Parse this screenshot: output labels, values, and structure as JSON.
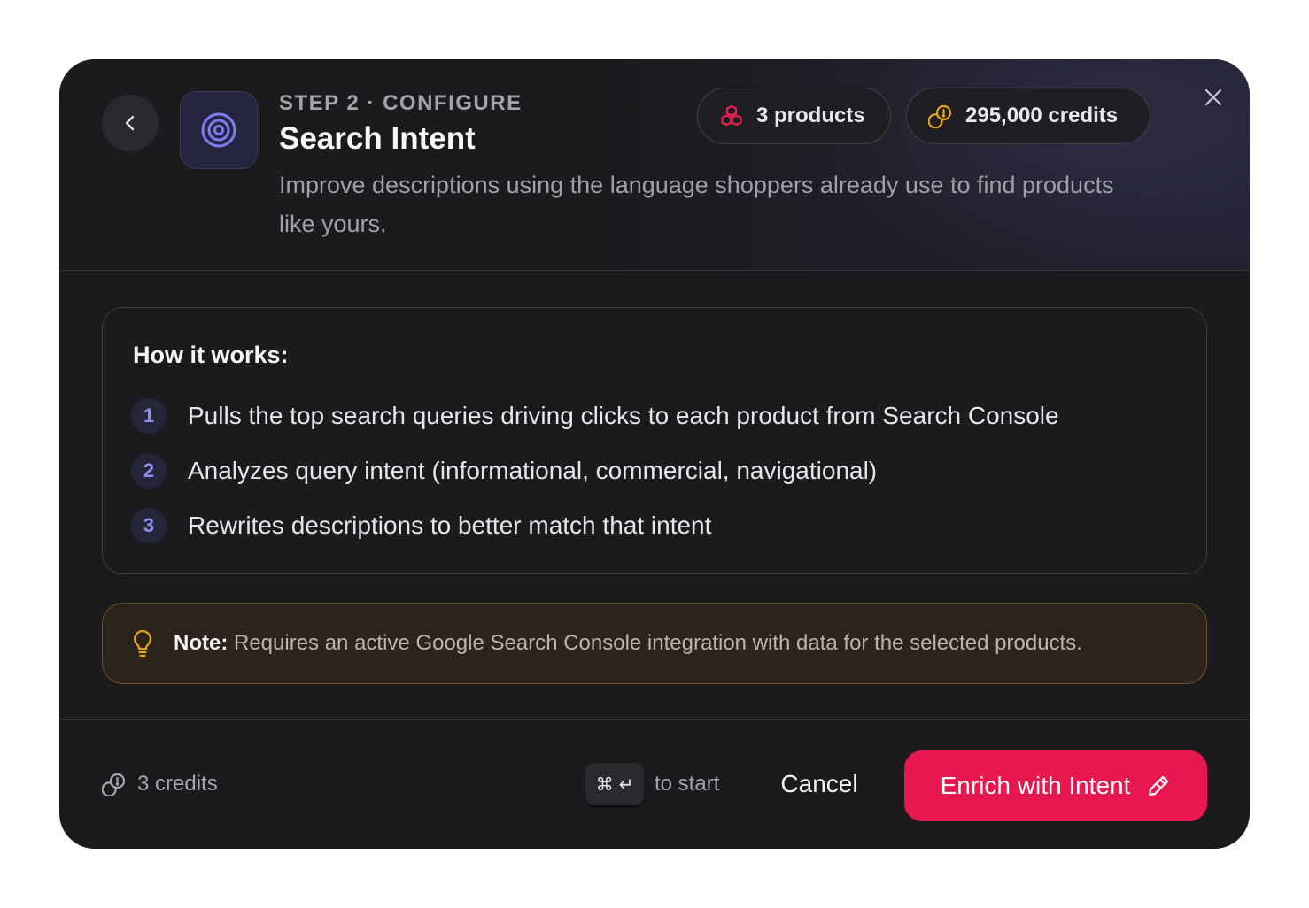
{
  "header": {
    "step_label": "STEP 2 · CONFIGURE",
    "title": "Search Intent",
    "subtitle": "Improve descriptions using the language shoppers already use to find products like yours.",
    "products_pill": "3 products",
    "credits_pill": "295,000 credits"
  },
  "how_it_works": {
    "title": "How it works:",
    "steps": [
      {
        "number": "1",
        "text": "Pulls the top search queries driving clicks to each product from Search Console"
      },
      {
        "number": "2",
        "text": "Analyzes query intent (informational, commercial, navigational)"
      },
      {
        "number": "3",
        "text": "Rewrites descriptions to better match that intent"
      }
    ]
  },
  "note": {
    "label": "Note:",
    "text": " Requires an active Google Search Console integration with data for the selected products."
  },
  "footer": {
    "cost": "3 credits",
    "shortcut_keys": [
      "⌘",
      "↵"
    ],
    "shortcut_hint": "to start",
    "cancel_label": "Cancel",
    "primary_label": "Enrich with Intent"
  },
  "colors": {
    "accent": "#e8174f",
    "step_number": "#8b8ef5",
    "tool_icon": "#7b7ef2",
    "credits_icon": "#e5a31c",
    "note_border": "#6e5324",
    "note_icon": "#e5a31c"
  },
  "icons": {
    "back": "chevron-left-icon",
    "tool": "target-icon",
    "products": "boxes-icon",
    "credits": "coins-icon",
    "close": "close-icon",
    "note": "lightbulb-icon",
    "cost": "coins-icon",
    "primary": "pencil-icon"
  }
}
